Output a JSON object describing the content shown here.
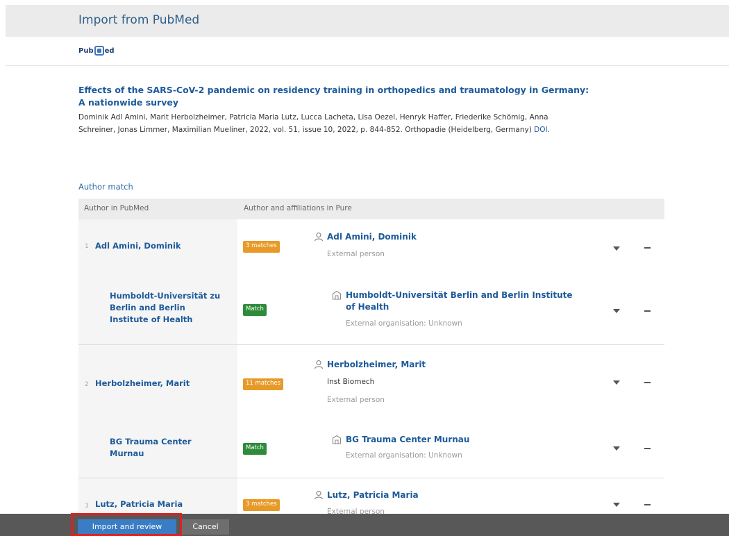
{
  "header": {
    "title": "Import from PubMed"
  },
  "logo": {
    "text_left": "Pub",
    "text_right": "ed"
  },
  "publication": {
    "title_line1": "Effects of the SARS-CoV-2 pandemic on residency training in orthopedics and traumatology in Germany:",
    "title_line2": "A nationwide survey",
    "meta_line1": "Dominik Adl Amini, Marit Herbolzheimer, Patricia Maria Lutz, Lucca Lacheta, Lisa Oezel, Henryk Haffer, Friederike Schömig, Anna",
    "meta_line2": "Schreiner, Jonas Limmer, Maximilian Mueliner, 2022, vol. 51, issue 10, 2022, p. 844-852. Orthopadie (Heidelberg, Germany)",
    "doi_label": "DOI."
  },
  "author_match": {
    "section_label": "Author match",
    "col_author_pubmed": "Author in PubMed",
    "col_author_pure": "Author and affiliations in Pure",
    "rows": [
      {
        "index": "1",
        "author": "Adl Amini, Dominik",
        "badge": "3 matches",
        "match_name": "Adl Amini, Dominik",
        "match_sub": "External person",
        "affiliation": {
          "name_line1": "Humboldt-Universität zu",
          "name_line2": "Berlin and Berlin",
          "name_line3": "Institute of Health",
          "badge": "Match",
          "match_line1": "Humboldt-Universität Berlin and Berlin Institute",
          "match_line2": "of Health",
          "match_sub": "External organisation: Unknown"
        }
      },
      {
        "index": "2",
        "author": "Herbolzheimer, Marit",
        "badge": "11 matches",
        "match_name": "Herbolzheimer, Marit",
        "match_aff": "Inst Biomech",
        "match_sub": "External person",
        "affiliation": {
          "name_line1": "BG Trauma Center",
          "name_line2": "Murnau",
          "badge": "Match",
          "match_line1": "BG Trauma Center Murnau",
          "match_sub": "External organisation: Unknown"
        }
      },
      {
        "index": "3",
        "author": "Lutz, Patricia Maria",
        "badge": "3 matches",
        "match_name": "Lutz, Patricia Maria",
        "match_sub": "External person"
      }
    ]
  },
  "footer": {
    "import_label": "Import and review",
    "cancel_label": "Cancel"
  },
  "colors": {
    "accent": "#1d5a9a",
    "badge_orange": "#e89a28",
    "badge_green": "#2e8b3a",
    "highlight": "#e02020"
  },
  "icons": {
    "person": "person-icon",
    "organisation": "building-icon",
    "expand": "chevron-down-icon",
    "remove": "minus-icon"
  }
}
